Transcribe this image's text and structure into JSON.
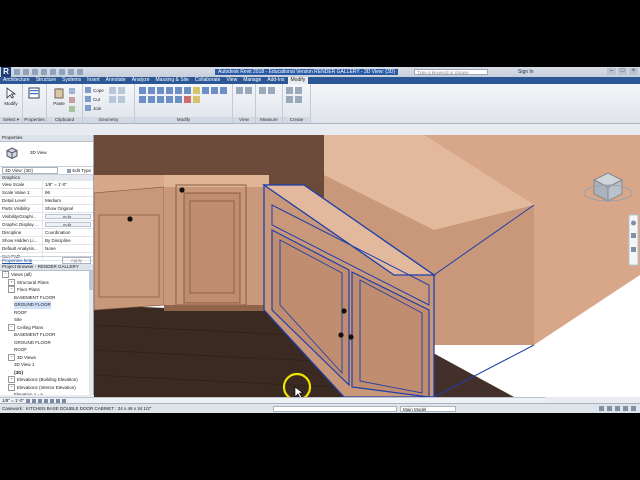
{
  "window": {
    "title": "Autodesk Revit 2018 - Educational Version  RENDER GALLERY - 3D View: {3D}",
    "search_placeholder": "Type a keyword or phrase",
    "sign_in": "Sign In",
    "controls": [
      "–",
      "□",
      "×"
    ]
  },
  "tabs": [
    "Architecture",
    "Structure",
    "Systems",
    "Insert",
    "Annotate",
    "Analyze",
    "Massing & Site",
    "Collaborate",
    "View",
    "Manage",
    "Add-Ins",
    "Modify"
  ],
  "ribbon": {
    "modify_label": "Modify",
    "select_label": "Select ▾",
    "properties_label": "Properties",
    "clipboard": {
      "label": "Clipboard",
      "paste": "Paste"
    },
    "geometry": {
      "label": "Geometry",
      "cope": "Cope",
      "cut": "Cut",
      "join": "Join"
    },
    "modify_panel_label": "Modify",
    "view_label": "View",
    "measure_label": "Measure",
    "create_label": "Create"
  },
  "properties": {
    "title": "Properties",
    "type_name": "3D View",
    "instance": "3D View: {3D}",
    "edit_type": "Edit Type",
    "section": "Graphics",
    "rows": [
      {
        "k": "View Scale",
        "v": "1/8\" = 1'-0\""
      },
      {
        "k": "Scale Value 1:",
        "v": "96"
      },
      {
        "k": "Detail Level",
        "v": "Medium"
      },
      {
        "k": "Parts Visibility",
        "v": "Show Original"
      },
      {
        "k": "Visibility/Graphi...",
        "v": "Edit..."
      },
      {
        "k": "Graphic Display ...",
        "v": "Edit..."
      },
      {
        "k": "Discipline",
        "v": "Coordination"
      },
      {
        "k": "Show Hidden Li...",
        "v": "By Discipline"
      },
      {
        "k": "Default Analysis...",
        "v": "None"
      },
      {
        "k": "Sun Path",
        "v": ""
      }
    ],
    "help": "Properties help",
    "apply": "Apply"
  },
  "browser": {
    "title": "Project Browser - RENDER GALLERY",
    "items": [
      {
        "label": "Views (all)",
        "level": 0,
        "toggle": "−"
      },
      {
        "label": "Structural Plans",
        "level": 1,
        "toggle": "+"
      },
      {
        "label": "Floor Plans",
        "level": 1,
        "toggle": "−"
      },
      {
        "label": "BASEMENT FLOOR",
        "level": 2,
        "toggle": ""
      },
      {
        "label": "GROUND FLOOR",
        "level": 2,
        "toggle": "",
        "selected": true
      },
      {
        "label": "ROOF",
        "level": 2,
        "toggle": ""
      },
      {
        "label": "Site",
        "level": 2,
        "toggle": ""
      },
      {
        "label": "Ceiling Plans",
        "level": 1,
        "toggle": "−"
      },
      {
        "label": "BASEMENT FLOOR",
        "level": 2,
        "toggle": ""
      },
      {
        "label": "GROUND FLOOR",
        "level": 2,
        "toggle": ""
      },
      {
        "label": "ROOF",
        "level": 2,
        "toggle": ""
      },
      {
        "label": "3D Views",
        "level": 1,
        "toggle": "−"
      },
      {
        "label": "3D View 1",
        "level": 2,
        "toggle": ""
      },
      {
        "label": "{3D}",
        "level": 2,
        "toggle": "",
        "bold": true
      },
      {
        "label": "Elevations (Building Elevation)",
        "level": 1,
        "toggle": "+"
      },
      {
        "label": "Elevations (Interior Elevation)",
        "level": 1,
        "toggle": "−"
      },
      {
        "label": "Elevation 1 - a",
        "level": 2,
        "toggle": ""
      }
    ]
  },
  "viewbar": {
    "scale": "1/8\" = 1'-0\""
  },
  "status": {
    "text": "Casework : KITCHEN BASE DOUBLE DOOR CABINET : 24 x 48 x 34 1/2\"",
    "model": "Main Model"
  },
  "colors": {
    "ribbon_tab_bar": "#2b5797",
    "cabinet": "#c9977a",
    "floor": "#3b2a22",
    "selection": "#1f3fa8",
    "cursor_highlight": "#f0e400"
  }
}
